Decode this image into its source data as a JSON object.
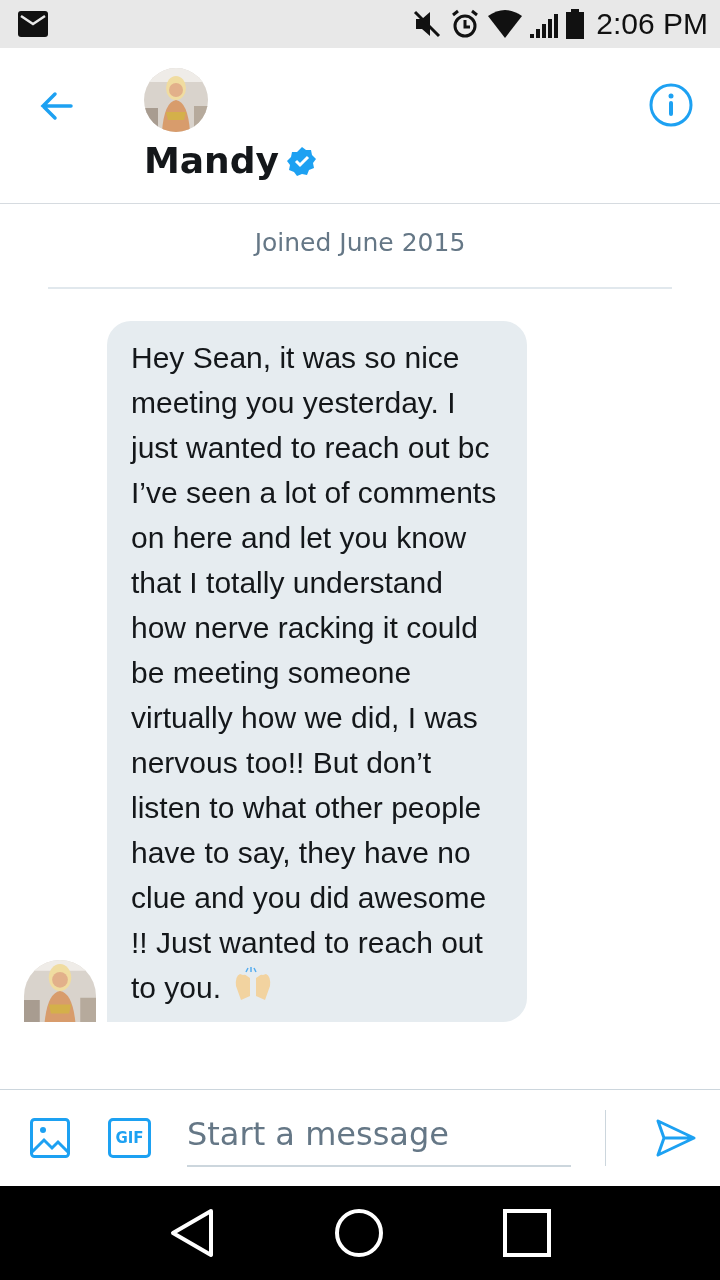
{
  "status_bar": {
    "time": "2:06 PM"
  },
  "header": {
    "name": "Mandy",
    "verified": true
  },
  "conversation": {
    "joined": "Joined June 2015",
    "messages": [
      {
        "text": "Hey Sean, it was so nice meeting you yesterday. I just wanted to reach out bc I’ve seen a lot of comments on here and let you know that I totally understand how nerve racking it could be meeting someone virtually how we did, I was nervous too!! But don’t listen to what other people have to say, they have no clue and you did awesome !! Just wanted to reach out to you.",
        "emoji": true
      }
    ]
  },
  "composer": {
    "gif_label": "GIF",
    "placeholder": "Start a message"
  }
}
